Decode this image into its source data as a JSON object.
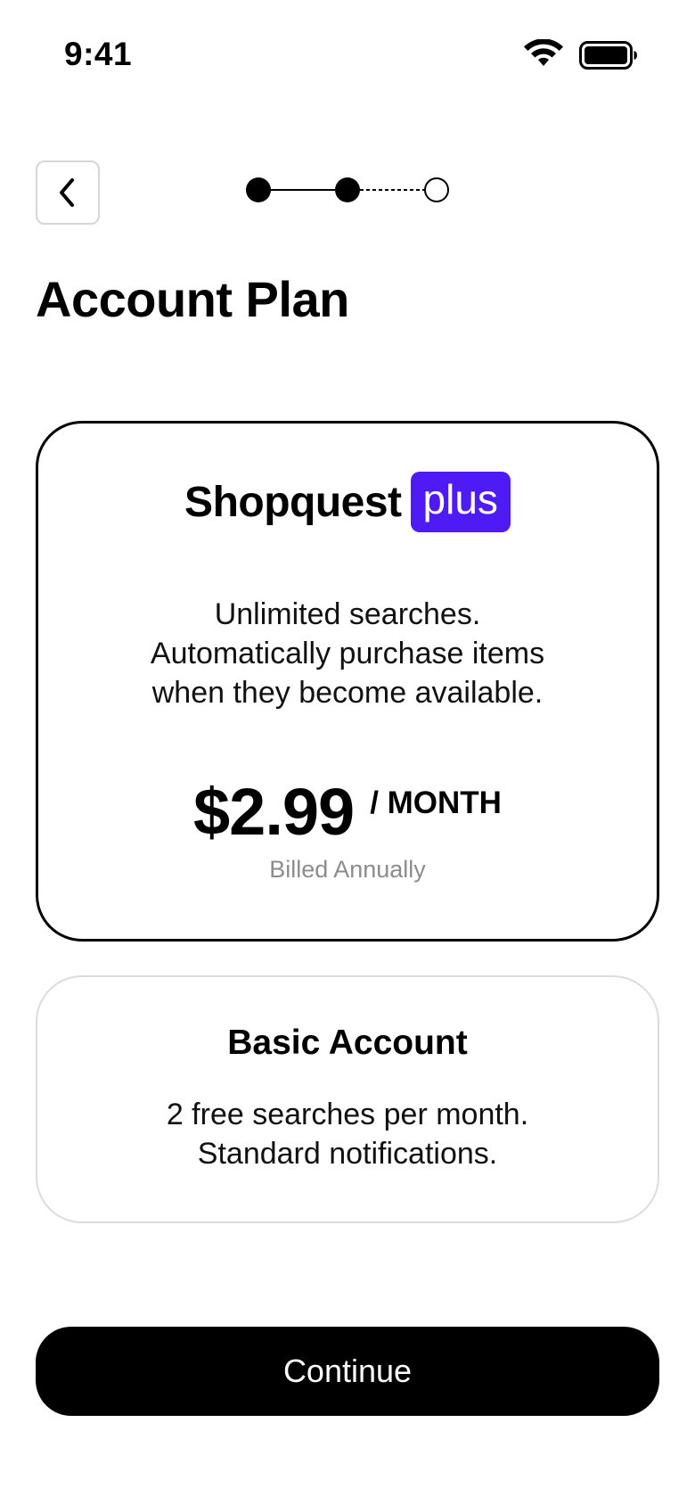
{
  "status_bar": {
    "time": "9:41",
    "wifi_icon": "wifi-icon",
    "battery_icon": "battery-icon"
  },
  "header": {
    "back_icon": "chevron-left-icon",
    "progress": {
      "total_steps": 3,
      "completed_steps": 2
    }
  },
  "page": {
    "title": "Account Plan"
  },
  "plans": {
    "premium": {
      "brand": "Shopquest",
      "badge": "plus",
      "badge_color": "#4f1bf5",
      "description_lines": [
        "Unlimited searches.",
        "Automatically purchase items",
        "when they become available."
      ],
      "price": "$2.99",
      "period": "/ MONTH",
      "billing_note": "Billed Annually",
      "selected": true
    },
    "basic": {
      "title": "Basic Account",
      "description_lines": [
        "2 free searches per month.",
        "Standard notifications."
      ],
      "selected": false
    }
  },
  "footer": {
    "continue_label": "Continue"
  }
}
